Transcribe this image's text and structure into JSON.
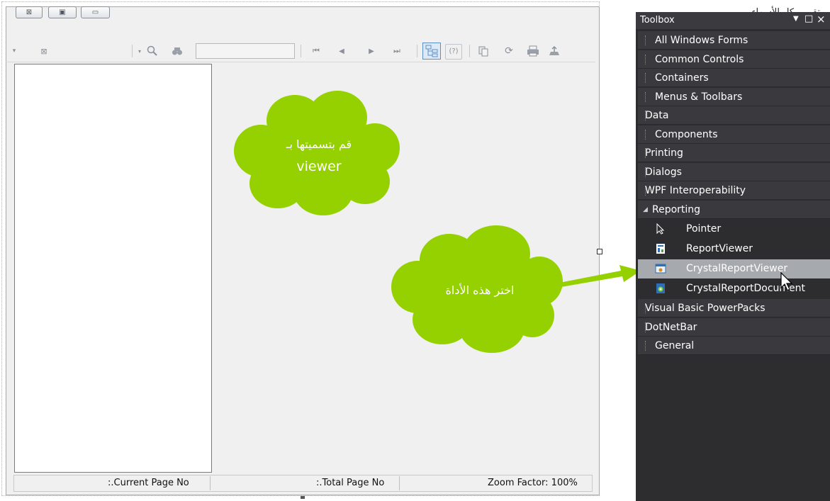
{
  "form": {
    "title": "تقرير بكل الأسماء",
    "titlebar_buttons": {
      "close": "⊠",
      "maximize": "▣",
      "minimize": "▭"
    },
    "search_value": ""
  },
  "statusbar": {
    "current_page": ":.Current Page No",
    "total_page": ":.Total Page No",
    "zoom": "Zoom Factor: 100%"
  },
  "annotations": {
    "cloud1_line1": "قم بتسميتها بـ",
    "cloud1_line2": "viewer",
    "cloud2": "اختر هذه الأداة"
  },
  "colors": {
    "cloud": "#95d100",
    "toolbox_bg": "#2d2d30",
    "selected": "#a6a9ae"
  },
  "toolbox": {
    "title": "Toolbox",
    "header_icons": [
      "dropdown-arrow-icon",
      "maximize-icon",
      "close-icon"
    ],
    "categories_top": [
      "All Windows Forms",
      "Common Controls",
      "Containers",
      "Menus & Toolbars",
      "Data",
      "Components",
      "Printing",
      "Dialogs",
      "WPF Interoperability"
    ],
    "reporting_label": "Reporting",
    "reporting_items": [
      "Pointer",
      "ReportViewer",
      "CrystalReportViewer",
      "CrystalReportDocument"
    ],
    "categories_bottom": [
      "Visual Basic PowerPacks",
      "DotNetBar",
      "General"
    ]
  }
}
